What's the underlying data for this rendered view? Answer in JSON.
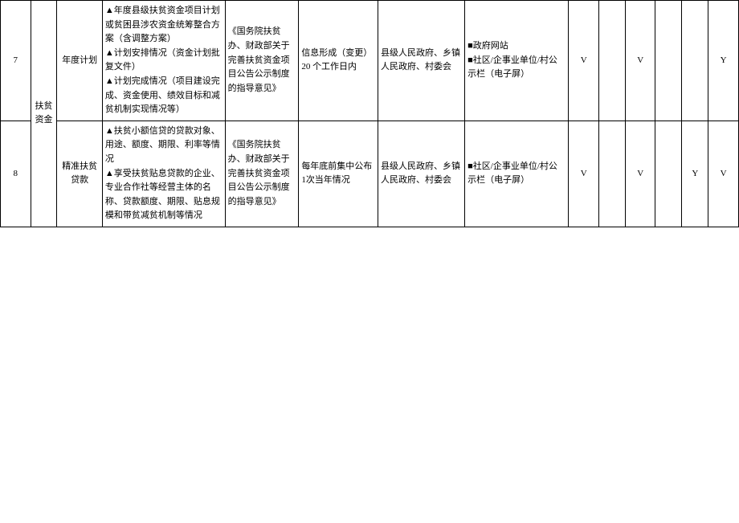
{
  "rows": [
    {
      "num": "7",
      "cat1": "扶贫资金",
      "cat2": "年度计划",
      "content": "▲年度县级扶贫资金项目计划或贫困县涉农资金统筹整合方案（含调整方案）\n▲计划安排情况（资金计划批复文件）\n▲计划完成情况（项目建设完成、资金使用、绩效目标和减贫机制实现情况等）",
      "basis": "《国务院扶贫办、财政部关于完善扶贫资金项目公告公示制度的指导意见》",
      "time": "信息形成（变更）20 个工作日内",
      "subject": "县级人民政府、乡镇人民政府、村委会",
      "channel": "■政府网站\n■社区/企事业单位/村公示栏（电子屏）",
      "m1": "V",
      "m2": "",
      "m3": "V",
      "m4": "",
      "m5": "",
      "m6": "Y"
    },
    {
      "num": "8",
      "cat2": "精准扶贫贷款",
      "content": "▲扶贫小额信贷的贷款对象、用途、额度、期限、利率等情况\n▲享受扶贫贴息贷款的企业、专业合作社等经营主体的名称、贷款额度、期限、贴息规模和带贫减贫机制等情况",
      "basis": "《国务院扶贫办、财政部关于完善扶贫资金项目公告公示制度的指导意见》",
      "time": "每年底前集中公布1次当年情况",
      "subject": "县级人民政府、乡镇人民政府、村委会",
      "channel": "■社区/企事业单位/村公示栏（电子屏）",
      "m1": "V",
      "m2": "",
      "m3": "V",
      "m4": "",
      "m5": "Y",
      "m6": "V"
    }
  ]
}
